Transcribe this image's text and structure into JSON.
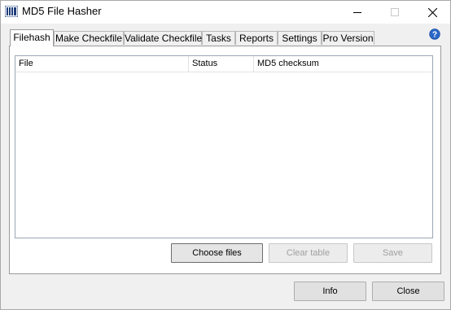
{
  "window": {
    "title": "MD5 File Hasher",
    "icons": {
      "app": "app-icon",
      "minimize": "minimize-icon",
      "maximize": "maximize-icon",
      "close": "close-icon"
    }
  },
  "tabs": [
    {
      "label": "Filehash",
      "active": true
    },
    {
      "label": "Make Checkfile"
    },
    {
      "label": "Validate Checkfile"
    },
    {
      "label": "Tasks"
    },
    {
      "label": "Reports"
    },
    {
      "label": "Settings"
    },
    {
      "label": "Pro Version"
    }
  ],
  "help_icon": "help-icon",
  "table": {
    "columns": [
      "File",
      "Status",
      "MD5 checksum"
    ],
    "rows": []
  },
  "panel_buttons": {
    "choose_files": "Choose files",
    "clear_table": "Clear table",
    "save": "Save"
  },
  "footer_buttons": {
    "info": "Info",
    "close": "Close"
  },
  "colors": {
    "help_icon": "#2b67c9",
    "disabled_text": "#a0a0a0"
  }
}
